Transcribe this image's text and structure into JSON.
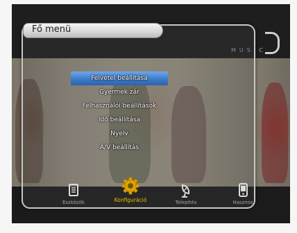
{
  "window": {
    "title": "Fő menü",
    "brand_partial": "SO",
    "channel_tag": "MUSIC"
  },
  "menu": {
    "items": [
      {
        "label": "Felvétel beállítása",
        "selected": true
      },
      {
        "label": "Gyermek zár",
        "selected": false
      },
      {
        "label": "Felhasználói beállítások",
        "selected": false
      },
      {
        "label": "Idő beállítása",
        "selected": false
      },
      {
        "label": "Nyelv",
        "selected": false
      },
      {
        "label": "A/V beállítás",
        "selected": false
      }
    ]
  },
  "bottom_bar": {
    "items": [
      {
        "label": "Eszközök",
        "icon": "document-icon",
        "active": false
      },
      {
        "label": "Konfiguráció",
        "icon": "gear-icon",
        "active": true
      },
      {
        "label": "Telepítés",
        "icon": "satellite-dish-icon",
        "active": false
      },
      {
        "label": "Hasznos",
        "icon": "handheld-icon",
        "active": false
      }
    ]
  },
  "colors": {
    "selection": "#3a78c8",
    "active_label": "#f0c000",
    "panel_border": "#c9c9c9"
  }
}
